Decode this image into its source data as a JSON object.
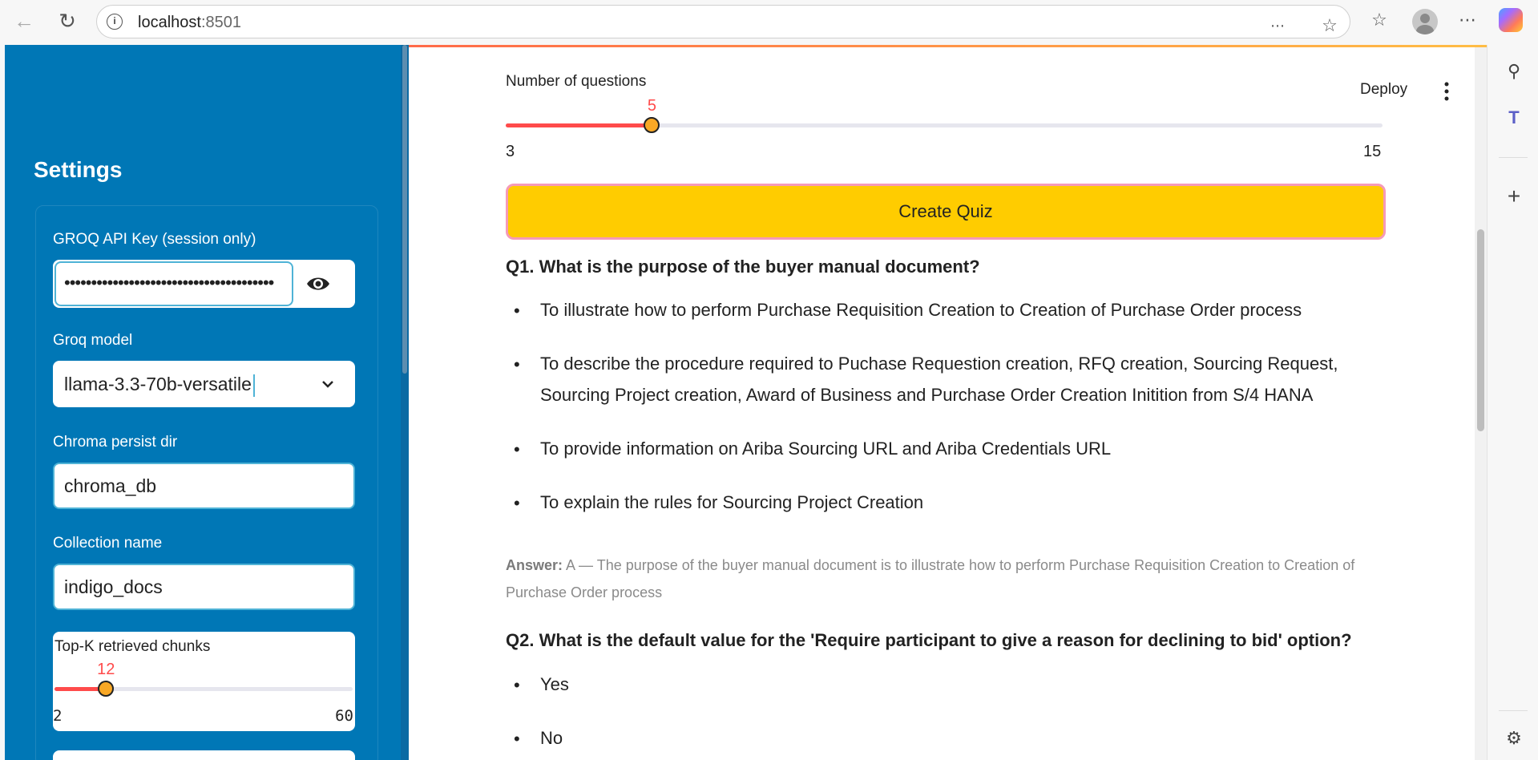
{
  "browser": {
    "url_host": "localhost",
    "url_port": ":8501"
  },
  "sidebar": {
    "title": "Settings",
    "api_key": {
      "label": "GROQ API Key (session only)",
      "value": "•••••••••••••••••••••••••••••••••••••••"
    },
    "model": {
      "label": "Groq model",
      "selected": "llama-3.3-70b-versatile"
    },
    "chroma": {
      "label": "Chroma persist dir",
      "value": "chroma_db"
    },
    "collection": {
      "label": "Collection name",
      "value": "indigo_docs"
    },
    "topk": {
      "label": "Top-K retrieved chunks",
      "value": 12,
      "min": 2,
      "max": 60,
      "value_text": "12",
      "min_text": "2",
      "max_text": "60"
    }
  },
  "header": {
    "deploy_label": "Deploy"
  },
  "main": {
    "num_questions": {
      "label": "Number of questions",
      "value": 5,
      "min": 3,
      "max": 15,
      "value_text": "5",
      "min_text": "3",
      "max_text": "15"
    },
    "create_button": "Create Quiz",
    "questions": [
      {
        "title": "Q1. What is the purpose of the buyer manual document?",
        "options": [
          "To illustrate how to perform Purchase Requisition Creation to Creation of Purchase Order process",
          "To describe the procedure required to Puchase Requestion creation, RFQ creation, Sourcing Request, Sourcing Project creation, Award of Business and Purchase Order Creation Initition from S/4 HANA",
          "To provide information on Ariba Sourcing URL and Ariba Credentials URL",
          "To explain the rules for Sourcing Project Creation"
        ],
        "answer_label": "Answer:",
        "answer_text": "A — The purpose of the buyer manual document is to illustrate how to perform Purchase Requisition Creation to Creation of Purchase Order process"
      },
      {
        "title": "Q2. What is the default value for the 'Require participant to give a reason for declining to bid' option?",
        "options": [
          "Yes",
          "No"
        ]
      }
    ]
  },
  "colors": {
    "sidebar_bg": "#0077b6",
    "accent": "#ff4b4b",
    "button_bg": "#ffcc00"
  }
}
